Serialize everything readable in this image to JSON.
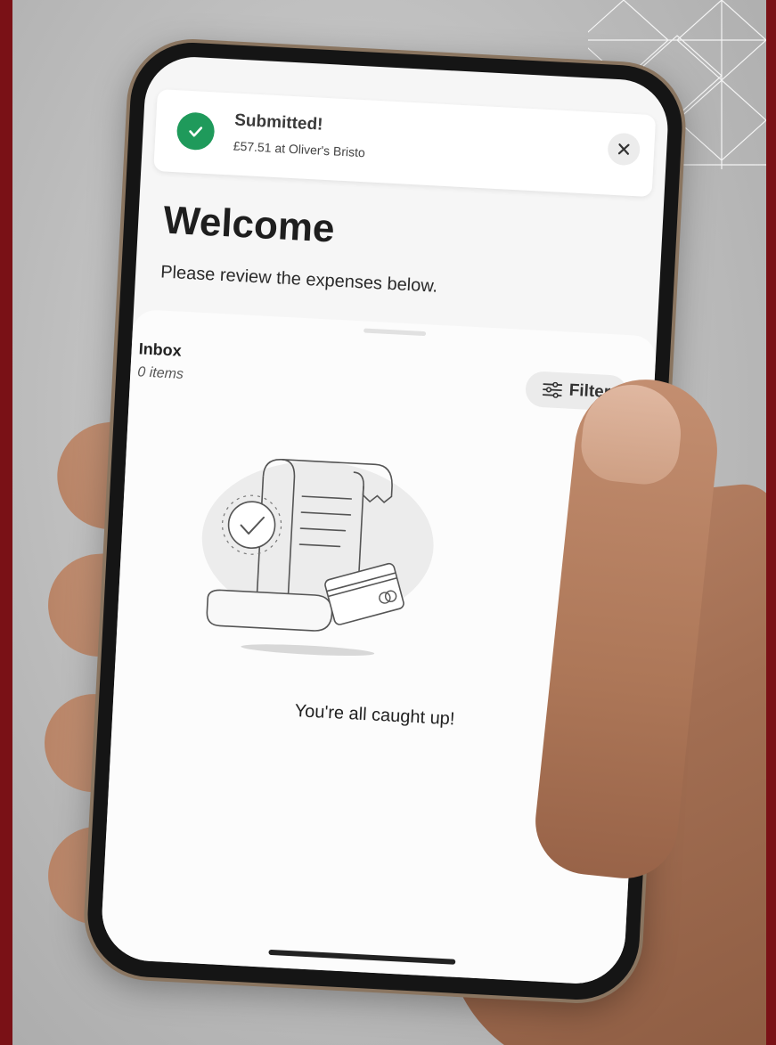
{
  "colors": {
    "border": "#7a1116",
    "success_green": "#1f9a5b",
    "screen_bg": "#f6f6f6"
  },
  "toast": {
    "title": "Submitted!",
    "subtitle": "£57.51 at Oliver's Bristo",
    "status_icon": "check-circle-icon",
    "close_icon": "close-icon"
  },
  "header": {
    "title": "Welcome",
    "subtitle": "Please review the expenses below."
  },
  "inbox": {
    "label": "Inbox",
    "count": "0 items",
    "filter_label": "Filter",
    "filter_icon": "sliders-icon"
  },
  "empty_state": {
    "illustration": "receipt-illustration",
    "message": "You're all caught up!"
  }
}
